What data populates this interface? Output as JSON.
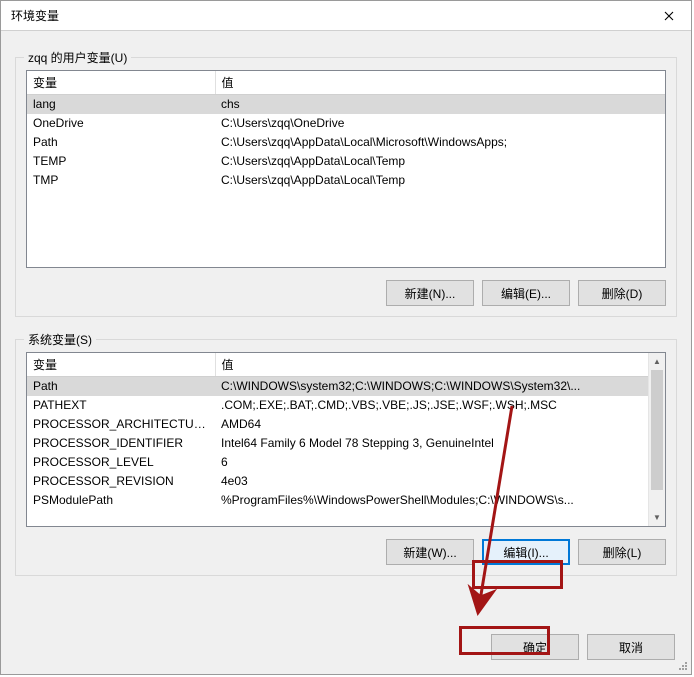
{
  "title": "环境变量",
  "user_section": {
    "label": "zqq 的用户变量(U)",
    "columns": [
      "变量",
      "值"
    ],
    "rows": [
      {
        "name": "lang",
        "value": "chs",
        "selected": true
      },
      {
        "name": "OneDrive",
        "value": "C:\\Users\\zqq\\OneDrive"
      },
      {
        "name": "Path",
        "value": "C:\\Users\\zqq\\AppData\\Local\\Microsoft\\WindowsApps;"
      },
      {
        "name": "TEMP",
        "value": "C:\\Users\\zqq\\AppData\\Local\\Temp"
      },
      {
        "name": "TMP",
        "value": "C:\\Users\\zqq\\AppData\\Local\\Temp"
      }
    ],
    "buttons": {
      "new": "新建(N)...",
      "edit": "编辑(E)...",
      "delete": "删除(D)"
    }
  },
  "system_section": {
    "label": "系统变量(S)",
    "columns": [
      "变量",
      "值"
    ],
    "rows": [
      {
        "name": "Path",
        "value": "C:\\WINDOWS\\system32;C:\\WINDOWS;C:\\WINDOWS\\System32\\...",
        "selected": true
      },
      {
        "name": "PATHEXT",
        "value": ".COM;.EXE;.BAT;.CMD;.VBS;.VBE;.JS;.JSE;.WSF;.WSH;.MSC"
      },
      {
        "name": "PROCESSOR_ARCHITECTURE",
        "value": "AMD64"
      },
      {
        "name": "PROCESSOR_IDENTIFIER",
        "value": "Intel64 Family 6 Model 78 Stepping 3, GenuineIntel"
      },
      {
        "name": "PROCESSOR_LEVEL",
        "value": "6"
      },
      {
        "name": "PROCESSOR_REVISION",
        "value": "4e03"
      },
      {
        "name": "PSModulePath",
        "value": "%ProgramFiles%\\WindowsPowerShell\\Modules;C:\\WINDOWS\\s..."
      }
    ],
    "buttons": {
      "new": "新建(W)...",
      "edit": "编辑(I)...",
      "delete": "删除(L)"
    }
  },
  "dialog_buttons": {
    "ok": "确定",
    "cancel": "取消"
  },
  "annotation_color": "#a31515"
}
